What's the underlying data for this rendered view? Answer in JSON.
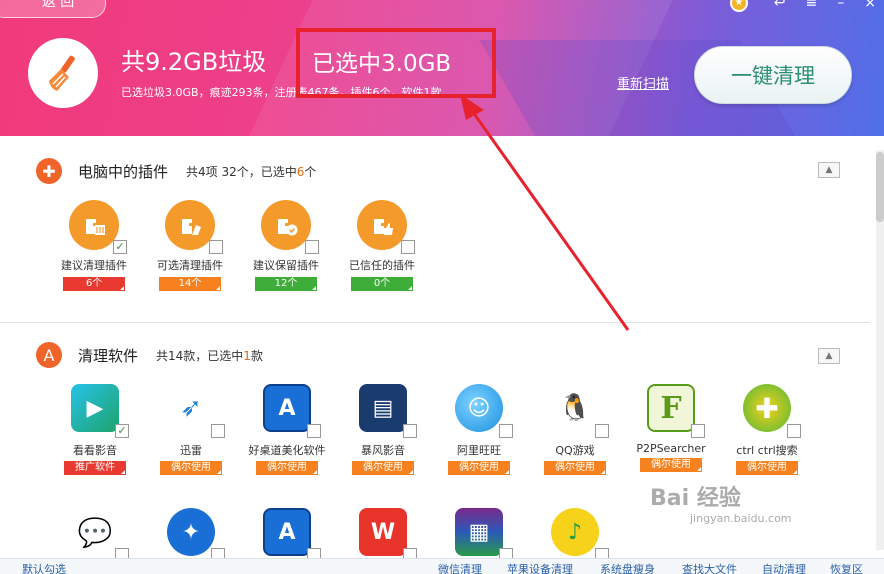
{
  "header": {
    "back_label": "返 回",
    "title": "共9.2GB垃圾",
    "selected": "已选中3.0GB",
    "summary": "已选垃圾3.0GB，痕迹293条，注册表467条，插件6个，软件1款",
    "rescan": "重新扫描",
    "clean_button": "一键清理"
  },
  "plugins": {
    "title": "电脑中的插件",
    "desc_prefix": "共4项 32个，已选中",
    "desc_count": "6",
    "desc_suffix": "个",
    "items": [
      {
        "label": "建议清理插件",
        "badge": "6个",
        "checked": "✓",
        "color": "red"
      },
      {
        "label": "可选清理插件",
        "badge": "14个",
        "checked": "",
        "color": "orange"
      },
      {
        "label": "建议保留插件",
        "badge": "12个",
        "checked": "",
        "color": "green"
      },
      {
        "label": "已信任的插件",
        "badge": "0个",
        "checked": "",
        "color": "green"
      }
    ]
  },
  "software": {
    "title": "清理软件",
    "desc_prefix": "共14款，已选中",
    "desc_count": "1",
    "desc_suffix": "款",
    "items": [
      {
        "label": "看看影音",
        "badge": "推广软件",
        "checked": "✓",
        "color": "red"
      },
      {
        "label": "迅雷",
        "badge": "偶尔使用",
        "checked": "",
        "color": "orange"
      },
      {
        "label": "好桌道美化软件",
        "badge": "偶尔使用",
        "checked": "",
        "color": "orange"
      },
      {
        "label": "暴风影音",
        "badge": "偶尔使用",
        "checked": "",
        "color": "orange"
      },
      {
        "label": "阿里旺旺",
        "badge": "偶尔使用",
        "checked": "",
        "color": "orange"
      },
      {
        "label": "QQ游戏",
        "badge": "偶尔使用",
        "checked": "",
        "color": "orange"
      },
      {
        "label": "P2PSearcher",
        "badge": "偶尔使用",
        "checked": "",
        "color": "orange"
      },
      {
        "label": "ctrl ctrl搜索",
        "badge": "偶尔使用",
        "checked": "",
        "color": "orange"
      }
    ]
  },
  "footer": {
    "default_check": "默认勾选",
    "links": [
      "微信清理",
      "苹果设备清理",
      "系统盘瘦身",
      "查找大文件",
      "自动清理",
      "恢复区"
    ]
  },
  "watermark": {
    "brand": "Bai 经验",
    "url": "jingyan.baidu.com"
  }
}
